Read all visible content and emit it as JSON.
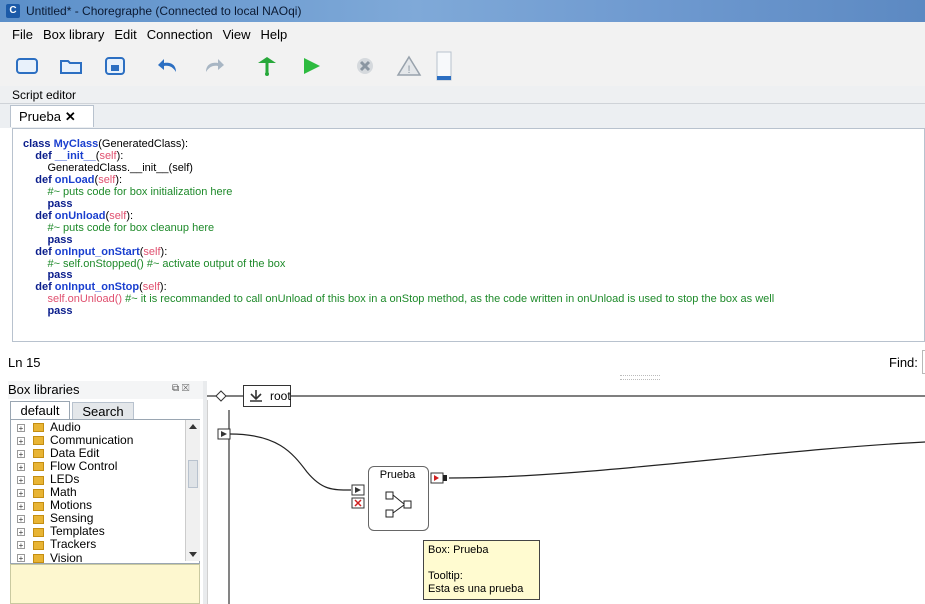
{
  "window": {
    "title": "Untitled* - Choregraphe (Connected to local NAOqi)",
    "app_icon_letter": "C"
  },
  "menu": [
    "File",
    "Box library",
    "Edit",
    "Connection",
    "View",
    "Help"
  ],
  "toolbar": {
    "buttons": [
      "new-file",
      "open-file",
      "save-file",
      "undo",
      "redo",
      "connect",
      "play",
      "stop",
      "warning",
      "volume"
    ]
  },
  "script_editor": {
    "dock_title": "Script editor",
    "tab_label": "Prueba",
    "tab_close": "✕",
    "code_lines": [
      {
        "indent": 0,
        "parts": [
          [
            "kw",
            "class "
          ],
          [
            "fn",
            "MyClass"
          ],
          [
            "nm",
            "(GeneratedClass):"
          ]
        ]
      },
      {
        "indent": 1,
        "parts": [
          [
            "kw",
            "def "
          ],
          [
            "fn",
            "__init__"
          ],
          [
            "nm",
            "("
          ],
          [
            "self",
            "self"
          ],
          [
            "nm",
            "):"
          ]
        ]
      },
      {
        "indent": 2,
        "parts": [
          [
            "nm",
            "GeneratedClass.__init__(self)"
          ]
        ]
      },
      {
        "indent": 1,
        "parts": [
          [
            "kw",
            "def "
          ],
          [
            "fn",
            "onLoad"
          ],
          [
            "nm",
            "("
          ],
          [
            "self",
            "self"
          ],
          [
            "nm",
            "):"
          ]
        ]
      },
      {
        "indent": 2,
        "parts": [
          [
            "cm",
            "#~ puts code for box initialization here"
          ]
        ]
      },
      {
        "indent": 2,
        "parts": [
          [
            "kw",
            "pass"
          ]
        ]
      },
      {
        "indent": 1,
        "parts": [
          [
            "kw",
            "def "
          ],
          [
            "fn",
            "onUnload"
          ],
          [
            "nm",
            "("
          ],
          [
            "self",
            "self"
          ],
          [
            "nm",
            "):"
          ]
        ]
      },
      {
        "indent": 2,
        "parts": [
          [
            "cm",
            "#~ puts code for box cleanup here"
          ]
        ]
      },
      {
        "indent": 2,
        "parts": [
          [
            "kw",
            "pass"
          ]
        ]
      },
      {
        "indent": 1,
        "parts": [
          [
            "kw",
            "def "
          ],
          [
            "fn",
            "onInput_onStart"
          ],
          [
            "nm",
            "("
          ],
          [
            "self",
            "self"
          ],
          [
            "nm",
            "):"
          ]
        ]
      },
      {
        "indent": 2,
        "parts": [
          [
            "cm",
            "#~ self.onStopped() #~ activate output of the box"
          ]
        ]
      },
      {
        "indent": 2,
        "parts": [
          [
            "kw",
            "pass"
          ]
        ]
      },
      {
        "indent": 1,
        "parts": [
          [
            "kw",
            "def "
          ],
          [
            "fn",
            "onInput_onStop"
          ],
          [
            "nm",
            "("
          ],
          [
            "self",
            "self"
          ],
          [
            "nm",
            "):"
          ]
        ]
      },
      {
        "indent": 2,
        "parts": [
          [
            "self",
            "self.onUnload() "
          ],
          [
            "cm",
            "#~ it is recommanded to call onUnload of this box in a onStop method, as the code written in onUnload is used to stop the box as well"
          ]
        ]
      },
      {
        "indent": 2,
        "parts": [
          [
            "kw",
            "pass"
          ]
        ]
      }
    ],
    "status_line": "Ln 15",
    "find_label": "Find:",
    "find_value": ""
  },
  "box_libraries": {
    "title": "Box libraries",
    "header_buttons": "⧉ ☒",
    "tabs": [
      "default",
      "Search"
    ],
    "items": [
      "Audio",
      "Communication",
      "Data Edit",
      "Flow Control",
      "LEDs",
      "Math",
      "Motions",
      "Sensing",
      "Templates",
      "Trackers",
      "Vision"
    ],
    "expander": "+"
  },
  "diagram": {
    "breadcrumb": "root",
    "box_name": "Prueba",
    "tooltip": {
      "line1": "Box: Prueba",
      "line2": "",
      "line3": "Tooltip:",
      "line4": "Esta es una prueba"
    }
  },
  "colors": {
    "keyword": "#0b1e8c",
    "function": "#1a3fcf",
    "self": "#e0506f",
    "comment": "#1e8a2a",
    "tooltip_bg": "#fffbd0",
    "library_desc_bg": "#fdf7cf"
  }
}
